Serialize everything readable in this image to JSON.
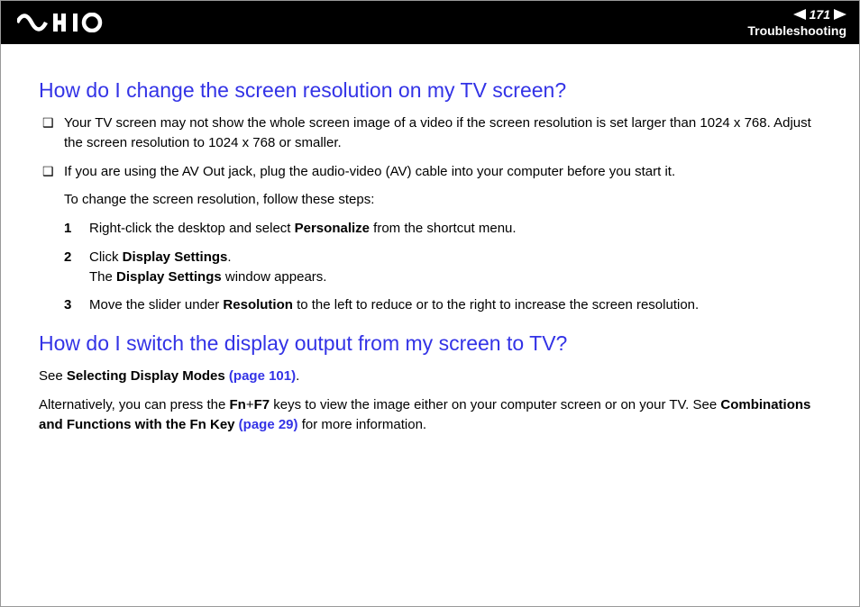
{
  "header": {
    "page_number": "171",
    "section": "Troubleshooting"
  },
  "q1": {
    "title": "How do I change the screen resolution on my TV screen?",
    "bullet1": "Your TV screen may not show the whole screen image of a video if the screen resolution is set larger than 1024 x 768. Adjust the screen resolution to 1024 x 768 or smaller.",
    "bullet2": "If you are using the AV Out jack, plug the audio-video (AV) cable into your computer before you start it.",
    "intro": "To change the screen resolution, follow these steps:",
    "steps": {
      "s1a": "Right-click the desktop and select ",
      "s1b": "Personalize",
      "s1c": " from the shortcut menu.",
      "s2a": "Click ",
      "s2b": "Display Settings",
      "s2c": ".",
      "s2d": "The ",
      "s2e": "Display Settings",
      "s2f": " window appears.",
      "s3a": "Move the slider under ",
      "s3b": "Resolution",
      "s3c": " to the left to reduce or to the right to increase the screen resolution."
    }
  },
  "q2": {
    "title": "How do I switch the display output from my screen to TV?",
    "p1a": "See ",
    "p1b": "Selecting Display Modes ",
    "p1c": "(page 101)",
    "p1d": ".",
    "p2a": "Alternatively, you can press the ",
    "p2b": "Fn",
    "p2c": "+",
    "p2d": "F7",
    "p2e": " keys to view the image either on your computer screen or on your TV. See ",
    "p2f": "Combinations and Functions with the Fn Key ",
    "p2g": "(page 29)",
    "p2h": " for more information."
  }
}
